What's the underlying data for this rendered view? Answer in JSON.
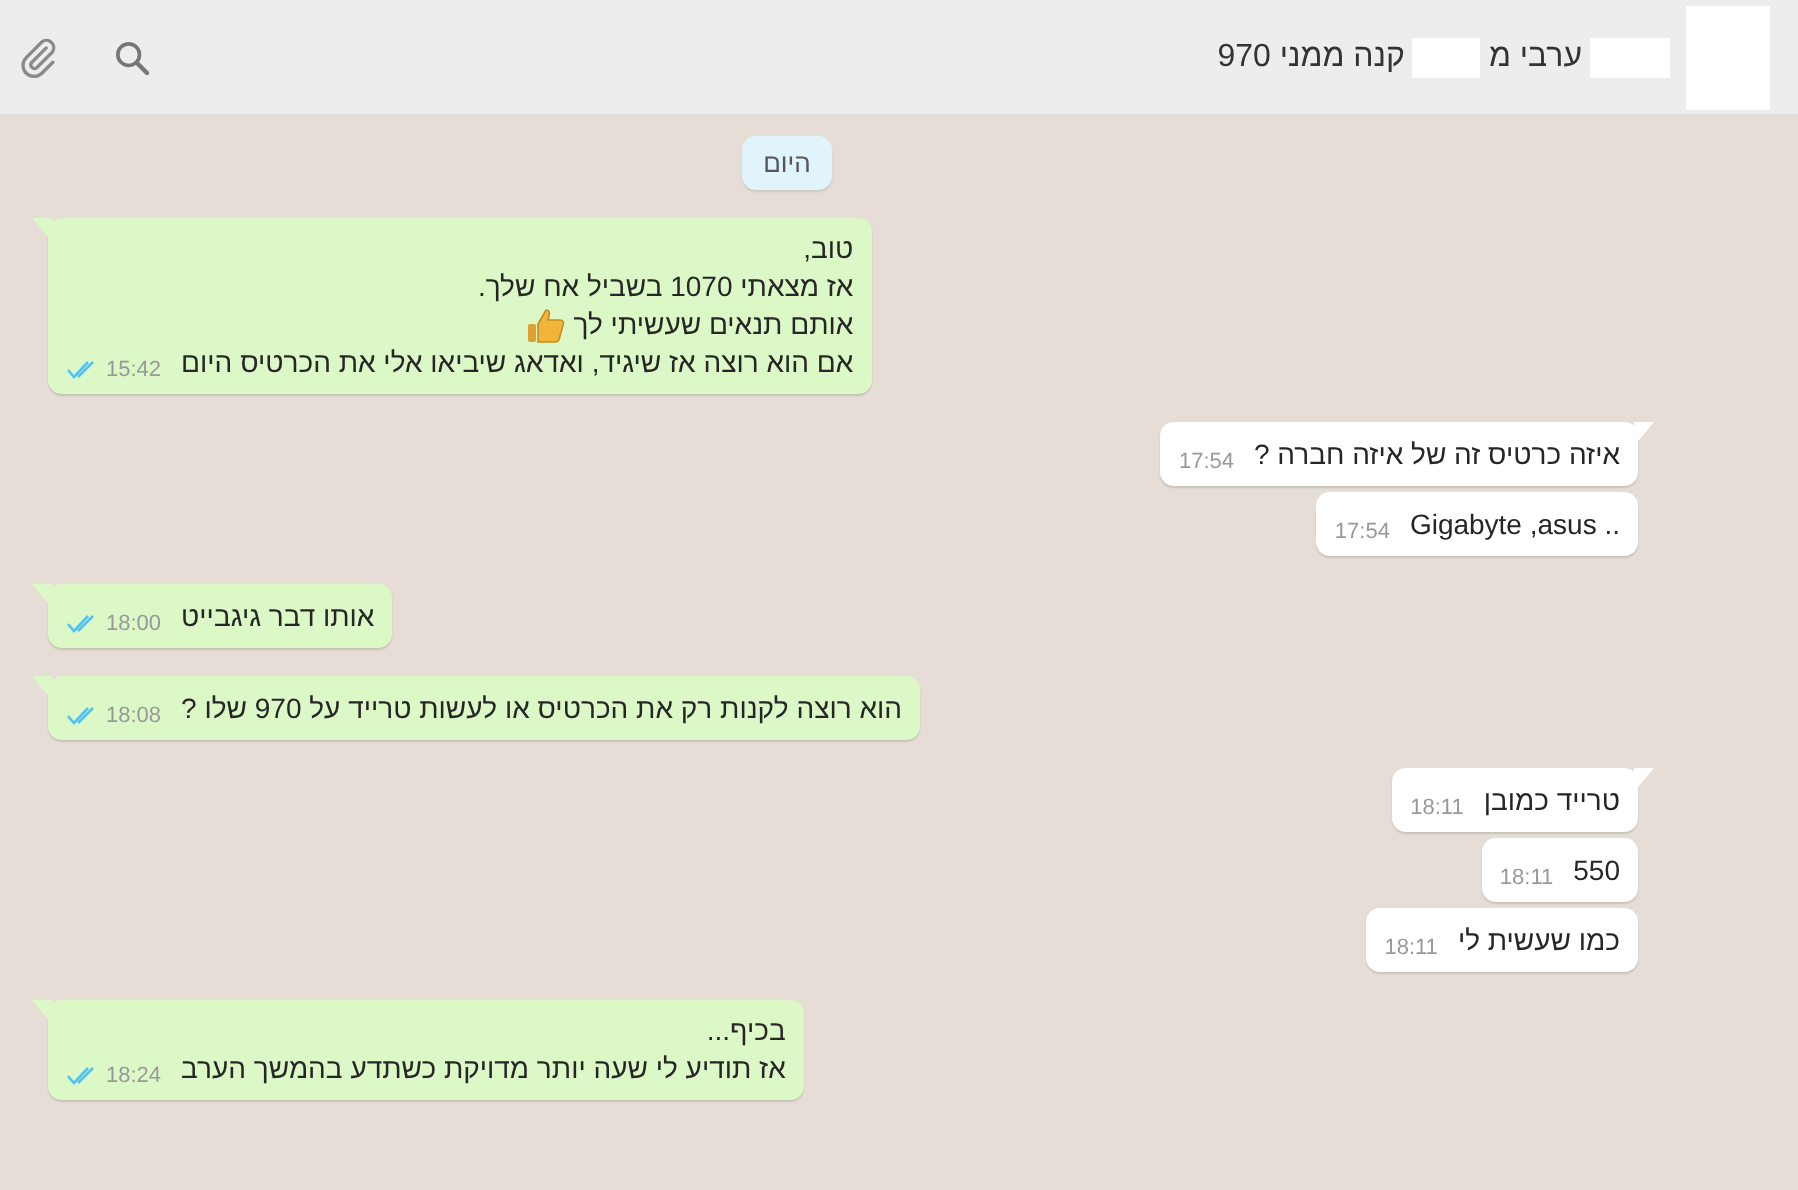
{
  "header": {
    "title": [
      {
        "kind": "redacted"
      },
      {
        "kind": "text",
        "text": "ערבי מ"
      },
      {
        "kind": "redacted"
      },
      {
        "kind": "text",
        "text": "קנה ממני 970"
      }
    ]
  },
  "date_chip": "היום",
  "messages": [
    {
      "kind": "outgoing",
      "tail": true,
      "read": true,
      "time": "15:42",
      "lines": [
        {
          "text": "טוב,"
        },
        {
          "text": "אז מצאתי 1070 בשביל אח שלך."
        },
        {
          "text": "אותם תנאים שעשיתי לך",
          "kind": "with-thumbs-up"
        },
        {
          "text": "אם הוא רוצה אז שיגיד, ואדאג שיביאו אלי את הכרטיס היום"
        }
      ]
    },
    {
      "kind": "incoming",
      "tail": true,
      "time": "17:54",
      "lines": [
        {
          "text": "איזה כרטיס זה של איזה חברה ?"
        }
      ]
    },
    {
      "kind": "incoming",
      "tail": false,
      "time": "17:54",
      "lines": [
        {
          "text": "Gigabyte ,asus .."
        }
      ]
    },
    {
      "kind": "outgoing",
      "tail": true,
      "read": true,
      "time": "18:00",
      "lines": [
        {
          "text": "אותו דבר גיגבייט"
        }
      ]
    },
    {
      "kind": "outgoing",
      "tail": true,
      "read": true,
      "time": "18:08",
      "lines": [
        {
          "text": "הוא רוצה לקנות רק את הכרטיס או לעשות טרייד על 970 שלו ?"
        }
      ]
    },
    {
      "kind": "incoming",
      "tail": true,
      "time": "18:11",
      "lines": [
        {
          "text": "טרייד כמובן"
        }
      ]
    },
    {
      "kind": "incoming",
      "tail": false,
      "time": "18:11",
      "lines": [
        {
          "text": "550"
        }
      ]
    },
    {
      "kind": "incoming",
      "tail": false,
      "time": "18:11",
      "lines": [
        {
          "text": "כמו שעשית לי"
        }
      ]
    },
    {
      "kind": "outgoing",
      "tail": true,
      "read": true,
      "time": "18:24",
      "lines": [
        {
          "text": "בכיף..."
        },
        {
          "text": "אז תודיע לי שעה יותר מדויקת כשתדע בהמשך הערב"
        }
      ]
    }
  ]
}
